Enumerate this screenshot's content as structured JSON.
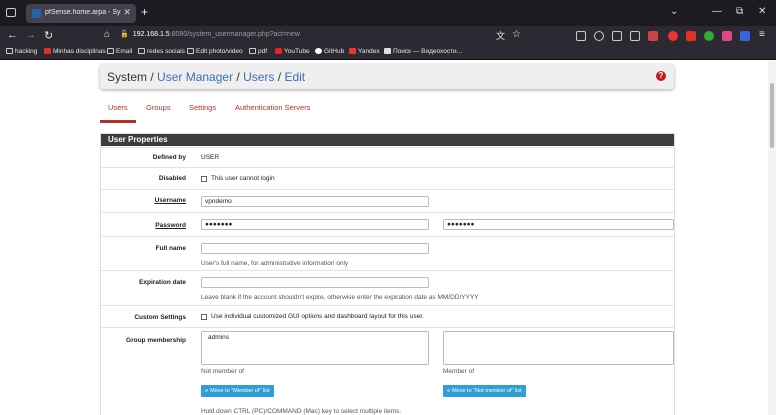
{
  "browser": {
    "tab_title": "pfSense.home.arpa - System: U",
    "tab_close": "✕",
    "new_tab": "+",
    "window_controls": {
      "dropdown": "⌄",
      "minimize": "—",
      "restore": "⧉",
      "close": "✕"
    },
    "url_host": "192.168.1.5",
    "url_rest": ":8080/system_usermanager.php?act=new",
    "bookmarks": [
      "hacking",
      "Minhas disciplinas",
      "Email",
      "redes sociais",
      "Edit photo/video",
      "pdf",
      "YouTube",
      "GitHub",
      "Yandex",
      "Поиск — Видеохости..."
    ]
  },
  "breadcrumb": {
    "root": "System",
    "sep1": " / ",
    "l1": "User Manager",
    "sep2": " / ",
    "l2": "Users",
    "sep3": " / ",
    "l3": "Edit",
    "help": "?"
  },
  "tabs": [
    "Users",
    "Groups",
    "Settings",
    "Authentication Servers"
  ],
  "panel": {
    "title": "User Properties",
    "defined_by_label": "Defined by",
    "defined_by_value": "USER",
    "disabled_label": "Disabled",
    "disabled_text": "This user cannot login",
    "username_label": "Username",
    "username_value": "vpndemo",
    "password_label": "Password",
    "password_value": "●●●●●●●",
    "password_confirm_value": "●●●●●●●",
    "fullname_label": "Full name",
    "fullname_help": "User's full name, for administrative information only",
    "expiration_label": "Expiration date",
    "expiration_help": "Leave blank if the account shouldn't expire, otherwise enter the expiration date as MM/DD/YYYY",
    "custom_label": "Custom Settings",
    "custom_text": "Use individual customized GUI options and dashboard layout for this user.",
    "group_label": "Group membership",
    "not_member_items": [
      "admins"
    ],
    "not_member_caption": "Not member of",
    "member_caption": "Member of",
    "move_to_member": "Move to \"Member of\" list",
    "move_to_not_member": "Move to \"Not member of\" list",
    "multi_select_help": "Hold down CTRL (PC)/COMMAND (Mac) key to select multiple items."
  },
  "colors": {
    "accent": "#b0322c",
    "link": "#3b6fb0",
    "panel_header": "#3c3c3c",
    "button": "#2f9fd8"
  }
}
